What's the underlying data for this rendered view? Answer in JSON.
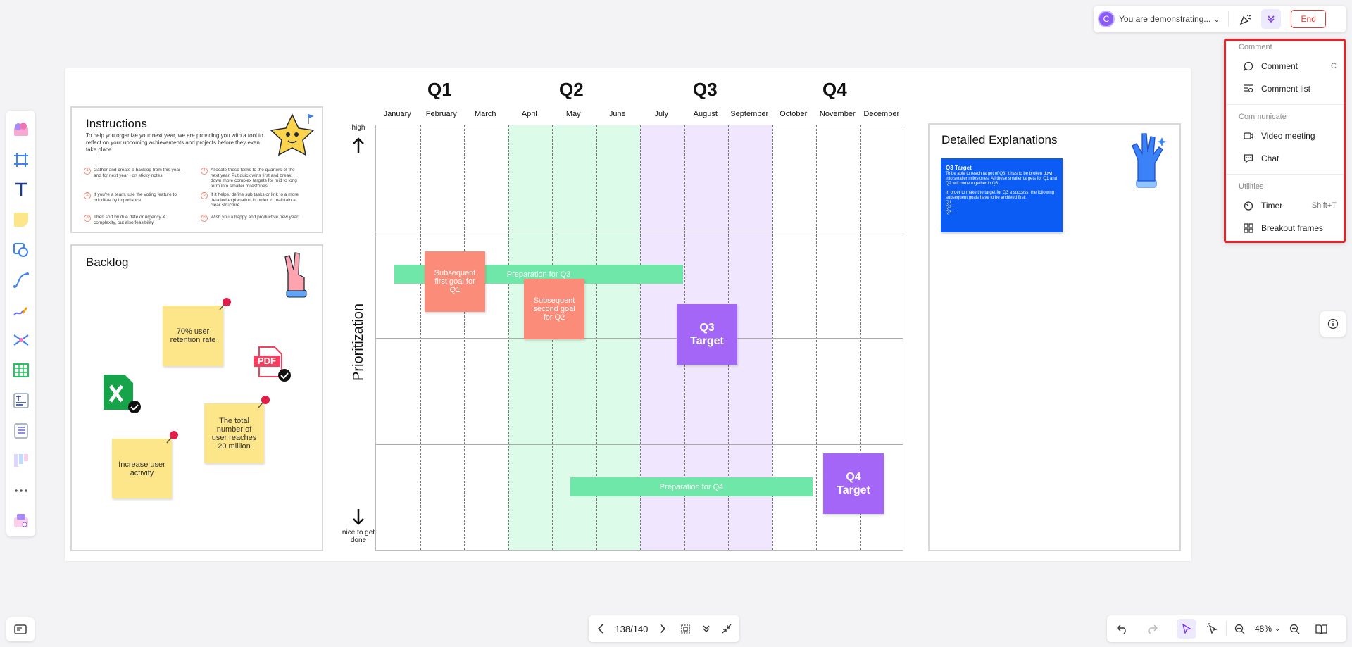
{
  "presentation": {
    "avatar_initial": "C",
    "status": "You are demonstrating...",
    "end_label": "End"
  },
  "menu": {
    "sections": [
      {
        "title": "Comment",
        "items": [
          {
            "label": "Comment",
            "shortcut": "C",
            "icon": "comment-icon"
          },
          {
            "label": "Comment list",
            "shortcut": "",
            "icon": "comment-list-icon"
          }
        ]
      },
      {
        "title": "Communicate",
        "items": [
          {
            "label": "Video meeting",
            "shortcut": "",
            "icon": "video-icon"
          },
          {
            "label": "Chat",
            "shortcut": "",
            "icon": "chat-icon"
          }
        ]
      },
      {
        "title": "Utilities",
        "items": [
          {
            "label": "Timer",
            "shortcut": "Shift+T",
            "icon": "timer-icon"
          },
          {
            "label": "Breakout frames",
            "shortcut": "",
            "icon": "breakout-frames-icon"
          }
        ]
      }
    ]
  },
  "instructions": {
    "title": "Instructions",
    "intro": "To help you organize your next year, we are providing you with a tool to reflect on your upcoming achievements and projects before they even take place.",
    "steps": [
      {
        "num": "1",
        "text": "Gather and create a backlog from this year - and for next year - on sticky notes."
      },
      {
        "num": "2",
        "text": "If you're a team, use the voting feature to prioritize by importance."
      },
      {
        "num": "3",
        "text": "Then sort by due date or urgency & complexity, but also feasibility."
      },
      {
        "num": "4",
        "text": "Allocate these tasks to the quarters of the next year. Put quick wins first and break down more complex targets for mid to long term into smaller milestones."
      },
      {
        "num": "5",
        "text": "If it helps, define sub tasks or link to a more detailed explanation in order to maintain a clear structure."
      },
      {
        "num": "6",
        "text": "Wish you a happy and productive new year!"
      }
    ]
  },
  "backlog": {
    "title": "Backlog",
    "notes": [
      "70% user retention rate",
      "The total number of user reaches 20 million",
      "Increase user activity"
    ],
    "pdf_label": "PDF"
  },
  "timeline": {
    "quarters": [
      "Q1",
      "Q2",
      "Q3",
      "Q4"
    ],
    "months": [
      "January",
      "February",
      "March",
      "April",
      "May",
      "June",
      "July",
      "August",
      "September",
      "October",
      "November",
      "December"
    ],
    "axis_label": "Prioritization",
    "high_label": "high",
    "low_label": "nice to get done",
    "bars": [
      "Preparation for Q3",
      "Preparation for Q4"
    ],
    "red_notes": [
      "Subsequent first goal for Q1",
      "Subsequent second goal for Q2"
    ],
    "purple_notes": [
      "Q3 Target",
      "Q4 Target"
    ]
  },
  "explanations": {
    "title": "Detailed Explanations",
    "card_title": "Q3 Target",
    "card_body": "To be able to reach target of Q3, it has to be broken down into smaller milestones. All these smaller targets for Q1 and Q2 will come together in Q3.",
    "card_body2": "In order to make the target for Q3 a success, the following subsequent goals have to be archived first:",
    "card_list": [
      "Q1 ...",
      "Q2 ...",
      "Q3 ..."
    ]
  },
  "page_nav": {
    "counter": "138/140"
  },
  "zoom": {
    "level": "48%"
  },
  "colors": {
    "accent": "#8b5cf6",
    "danger": "#e3222a",
    "green": "#6ee7a8",
    "red_note": "#fb8c7a",
    "purple_note": "#a466f6",
    "blue_card": "#0a5cf5"
  }
}
